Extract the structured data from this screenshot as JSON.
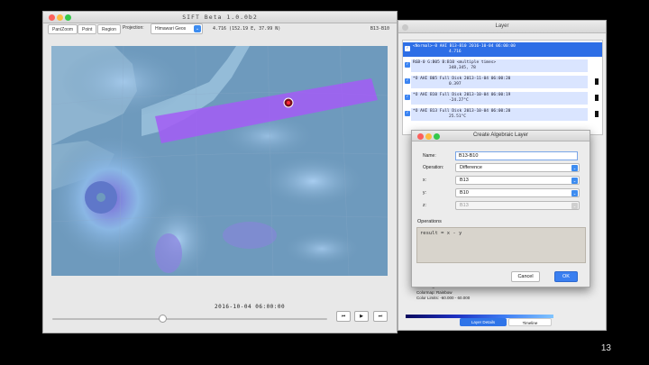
{
  "main_window": {
    "title": "SIFT Beta 1.0.0b2",
    "toolbar": {
      "pan_zoom": "Pan/Zoom",
      "point": "Point",
      "region": "Region",
      "projection_label": "Projection:",
      "projection_value": "Himawari Geos",
      "cursor_readout": "4.716  (152.19 E,  37.99 N)",
      "layer_name": "B13-B10"
    },
    "animation": {
      "timestamp": "2016-10-04 06:00:00",
      "prev": "⏮",
      "play": "▶",
      "next": "⏭",
      "progress": 0.4
    }
  },
  "layer_window": {
    "title": "Layer",
    "layers": [
      {
        "line1": "<Normal>-0 AHI B13-B10  2016-10-04 06:00:00",
        "line2": "4.716",
        "selected": true
      },
      {
        "line1": "RGB-0 G:B05 B:B10 <multiple times>",
        "line2": "348,345, 78",
        "selected": false
      },
      {
        "line1": "*O AHI B05 Full Disk 2013-11-04 06:00:20",
        "line2": "0.397",
        "selected": false
      },
      {
        "line1": "*O AHI B10 Full Disk 2013-10-04 06:00:19",
        "line2": "-24.27°C",
        "selected": false
      },
      {
        "line1": "*O AHI B13 Full Disk 2013-10-04 06:00:20",
        "line2": "25.51°C",
        "selected": false
      }
    ],
    "details": {
      "wavelength": "Wavelength: —",
      "colormap": "Colormap: Rainbow",
      "color_limits": "Color Limits: -60.000 - 60.000"
    },
    "tabs": {
      "details": "Layer Details",
      "timeline": "Timeline"
    }
  },
  "dialog": {
    "title": "Create Algebraic Layer",
    "name_label": "Name:",
    "name_value": "B13-B10",
    "operation_label": "Operation:",
    "operation_value": "Difference",
    "x_label": "x:",
    "x_value": "B13",
    "y_label": "y:",
    "y_value": "B10",
    "z_label": "z:",
    "z_value": "B13",
    "operations_label": "Operations",
    "operations_text": "result = x - y",
    "cancel": "Cancel",
    "ok": "OK"
  },
  "slide_number": "13",
  "colors": {
    "accent": "#3a7ff0",
    "selection": "#2d6ee6",
    "overlay": "#a35cf6"
  }
}
